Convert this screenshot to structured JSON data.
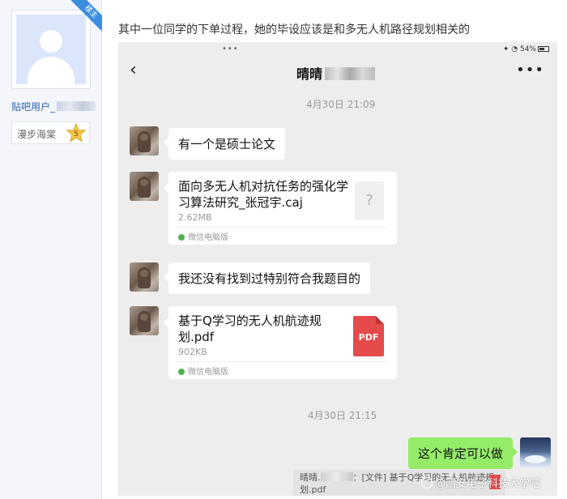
{
  "sidebar": {
    "ribbon_label": "楼主",
    "username_prefix": "贴吧用户_",
    "badge_title": "漫步海棠",
    "badge_level": "5"
  },
  "post": {
    "text": "其中一位同学的下单过程，她的毕设应该是和多无人机路径规划相关的"
  },
  "screenshot": {
    "status": {
      "dots": "•••",
      "battery_text": "54%"
    },
    "nav": {
      "back_icon": "‹",
      "title": "晴晴",
      "more_icon": "•••"
    },
    "messages": {
      "time_1": "4月30日 21:09",
      "msg_1": "有一个是硕士论文",
      "file_1": {
        "name": "面向多无人机对抗任务的强化学习算法研究_张冠宇.caj",
        "size": "2.62MB",
        "source": "微信电脑版",
        "icon": "?"
      },
      "msg_2": "我还没有找到过特别符合我题目的",
      "file_2": {
        "name": "基于Q学习的无人机航迹规划.pdf",
        "size": "902KB",
        "source": "微信电脑版",
        "icon": "PDF"
      },
      "time_2": "4月30日 21:15",
      "reply": "这个肯定可以做",
      "quote": {
        "sender": "晴晴.",
        "text": "：[文件] 基于Q学习的无人机航迹规划.pdf"
      }
    }
  },
  "watermark": "@西安电子科技大学吧",
  "colors": {
    "link_blue": "#2d64b3",
    "ribbon_blue": "#3b8de0",
    "chat_bg": "#ededed",
    "reply_green": "#95ec69",
    "pdf_red": "#e54b4b"
  }
}
